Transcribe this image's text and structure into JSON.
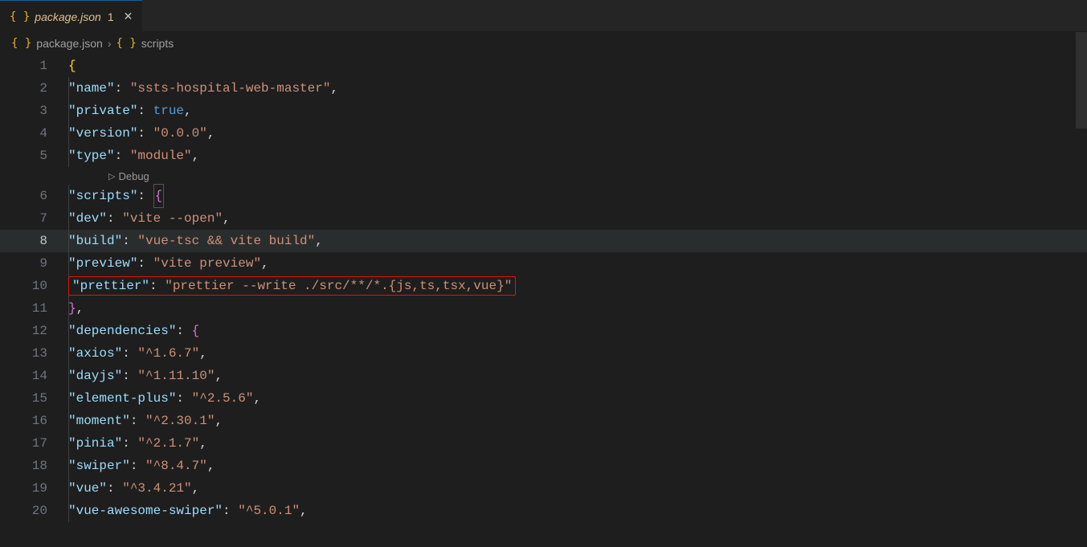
{
  "tab": {
    "filename": "package.json",
    "modified_indicator": "1"
  },
  "breadcrumb": {
    "file": "package.json",
    "path": "scripts"
  },
  "codelens": {
    "debug": "Debug"
  },
  "lines": {
    "l1": {
      "num": "1"
    },
    "l2": {
      "num": "2",
      "key": "\"name\"",
      "val": "\"ssts-hospital-web-master\""
    },
    "l3": {
      "num": "3",
      "key": "\"private\"",
      "val": "true"
    },
    "l4": {
      "num": "4",
      "key": "\"version\"",
      "val": "\"0.0.0\""
    },
    "l5": {
      "num": "5",
      "key": "\"type\"",
      "val": "\"module\""
    },
    "l6": {
      "num": "6",
      "key": "\"scripts\""
    },
    "l7": {
      "num": "7",
      "key": "\"dev\"",
      "val": "\"vite --open\""
    },
    "l8": {
      "num": "8",
      "key": "\"build\"",
      "val": "\"vue-tsc && vite build\""
    },
    "l9": {
      "num": "9",
      "key": "\"preview\"",
      "val": "\"vite preview\""
    },
    "l10": {
      "num": "10",
      "key": "\"prettier\"",
      "val": "\"prettier --write ./src/**/*.{js,ts,tsx,vue}\""
    },
    "l11": {
      "num": "11"
    },
    "l12": {
      "num": "12",
      "key": "\"dependencies\""
    },
    "l13": {
      "num": "13",
      "key": "\"axios\"",
      "val": "\"^1.6.7\""
    },
    "l14": {
      "num": "14",
      "key": "\"dayjs\"",
      "val": "\"^1.11.10\""
    },
    "l15": {
      "num": "15",
      "key": "\"element-plus\"",
      "val": "\"^2.5.6\""
    },
    "l16": {
      "num": "16",
      "key": "\"moment\"",
      "val": "\"^2.30.1\""
    },
    "l17": {
      "num": "17",
      "key": "\"pinia\"",
      "val": "\"^2.1.7\""
    },
    "l18": {
      "num": "18",
      "key": "\"swiper\"",
      "val": "\"^8.4.7\""
    },
    "l19": {
      "num": "19",
      "key": "\"vue\"",
      "val": "\"^3.4.21\""
    },
    "l20": {
      "num": "20",
      "key": "\"vue-awesome-swiper\"",
      "val": "\"^5.0.1\""
    }
  }
}
